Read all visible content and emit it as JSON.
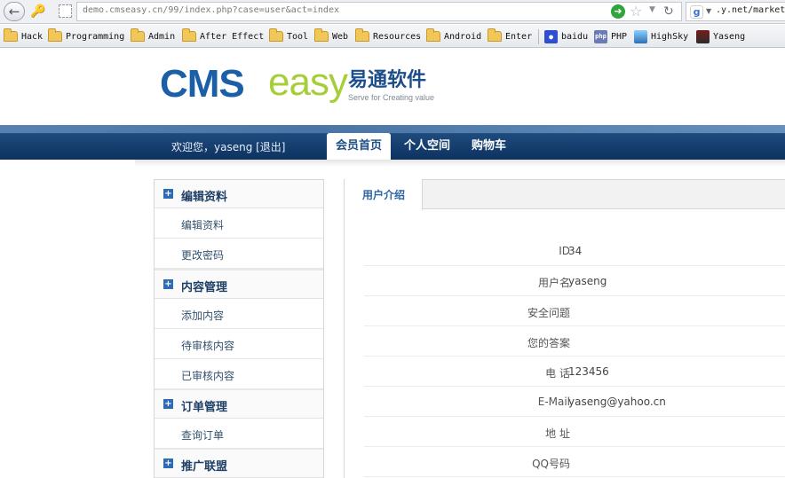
{
  "browser": {
    "url": "demo.cmseasy.cn/99/index.php?case=user&act=index",
    "search_text": ".y.net/market,",
    "icons": [
      "back-icon",
      "key-icon",
      "page-icon",
      "go-icon",
      "star-icon",
      "dropdown-icon",
      "reload-icon",
      "google-icon"
    ],
    "bookmarks": [
      {
        "label": "Hack",
        "icon": "folder-icon"
      },
      {
        "label": "Programming",
        "icon": "folder-icon"
      },
      {
        "label": "Admin",
        "icon": "folder-icon"
      },
      {
        "label": "After Effect",
        "icon": "folder-icon"
      },
      {
        "label": "Tool",
        "icon": "folder-icon"
      },
      {
        "label": "Web",
        "icon": "folder-icon"
      },
      {
        "label": "Resources",
        "icon": "folder-icon"
      },
      {
        "label": "Android",
        "icon": "folder-icon"
      },
      {
        "label": "Enter",
        "icon": "folder-icon"
      },
      {
        "label": "baidu",
        "icon": "baidu-paw-icon"
      },
      {
        "label": "PHP",
        "icon": "php-icon",
        "badge": "php"
      },
      {
        "label": "HighSky",
        "icon": "highsky-icon"
      },
      {
        "label": "Yaseng",
        "icon": "yaseng-icon"
      }
    ]
  },
  "header": {
    "logo_cms": "CMS",
    "logo_easy": "easy",
    "logo_cn": "易通软件",
    "logo_tagline": "Serve for Creating value"
  },
  "nav": {
    "welcome": "欢迎您，yaseng [退出]",
    "tabs": [
      {
        "label": "会员首页",
        "active": true
      },
      {
        "label": "个人空间",
        "active": false
      },
      {
        "label": "购物车",
        "active": false
      }
    ]
  },
  "sidebar": {
    "groups": [
      {
        "title": "编辑资料",
        "items": [
          "编辑资料",
          "更改密码"
        ]
      },
      {
        "title": "内容管理",
        "items": [
          "添加内容",
          "待审核内容",
          "已审核内容"
        ]
      },
      {
        "title": "订单管理",
        "items": [
          "查询订单"
        ]
      },
      {
        "title": "推广联盟",
        "items": []
      }
    ]
  },
  "main": {
    "tab": "用户介绍",
    "rows": [
      {
        "label": "ID",
        "value": "34"
      },
      {
        "label": "用户名",
        "value": "yaseng"
      },
      {
        "label": "安全问题",
        "value": ""
      },
      {
        "label": "您的答案",
        "value": ""
      },
      {
        "label": "电 话",
        "value": "123456"
      },
      {
        "label": "E-Mail",
        "value": "yaseng@yahoo.cn"
      },
      {
        "label": "地 址",
        "value": ""
      },
      {
        "label": "QQ号码",
        "value": ""
      }
    ]
  },
  "colors": {
    "nav_dark": "#0d3260",
    "nav_light": "#3d6b9b",
    "logo_blue": "#1b5fa8",
    "logo_green": "#a6ce39",
    "sidebar_title": "#1e3f66",
    "tab_text": "#2e63a4"
  }
}
